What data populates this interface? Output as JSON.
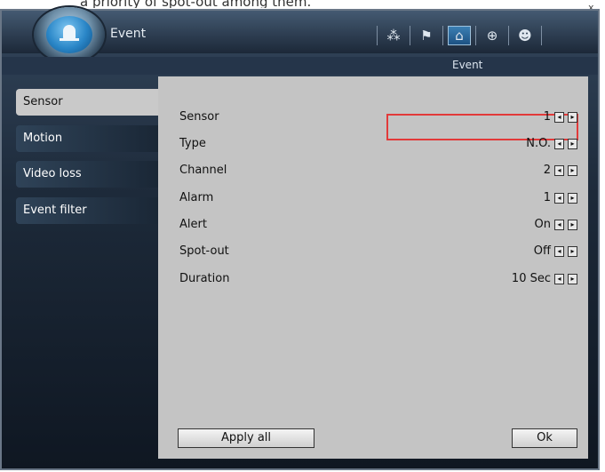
{
  "top_caption": "a priority of spot-out among them.",
  "window": {
    "close_label": "x",
    "title": "Event",
    "breadcrumb": "Event"
  },
  "toolbar": {
    "icons": [
      {
        "name": "setup-spark-icon",
        "glyph": "⁂"
      },
      {
        "name": "flag-icon",
        "glyph": "⚑"
      },
      {
        "name": "event-bell-icon",
        "glyph": "⌂",
        "active": true
      },
      {
        "name": "network-globe-icon",
        "glyph": "⊕"
      },
      {
        "name": "users-icon",
        "glyph": "☻"
      }
    ]
  },
  "sidebar": {
    "items": [
      {
        "label": "Sensor",
        "active": true
      },
      {
        "label": "Motion",
        "active": false
      },
      {
        "label": "Video loss",
        "active": false
      },
      {
        "label": "Event filter",
        "active": false
      }
    ]
  },
  "settings": {
    "rows": [
      {
        "label": "Sensor",
        "value": "1"
      },
      {
        "label": "Type",
        "value": "N.O."
      },
      {
        "label": "Channel",
        "value": "2"
      },
      {
        "label": "Alarm",
        "value": "1"
      },
      {
        "label": "Alert",
        "value": "On"
      },
      {
        "label": "Spot-out",
        "value": "Off"
      },
      {
        "label": "Duration",
        "value": "10 Sec"
      }
    ]
  },
  "buttons": {
    "apply_all": "Apply all",
    "ok": "Ok"
  },
  "colors": {
    "highlight": "#e23a3a",
    "panel": "#c4c4c4",
    "active_tab": "#c9c9c9"
  }
}
